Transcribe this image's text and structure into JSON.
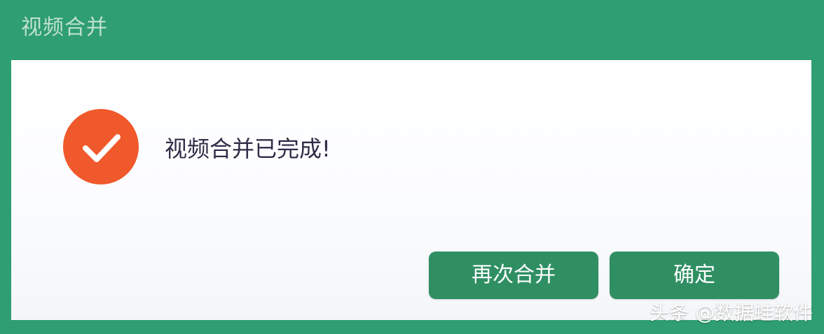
{
  "dialog": {
    "title": "视频合并",
    "message": "视频合并已完成!",
    "status_icon": "check-circle-icon",
    "buttons": {
      "merge_again": "再次合并",
      "confirm": "确定"
    }
  },
  "watermark": "头条 @数据蛙软件",
  "colors": {
    "frame": "#2f9e72",
    "title_text": "#bfe1d1",
    "icon_circle": "#f0592b",
    "button": "#2f8f63",
    "button_text": "#ffffff",
    "message_text": "#332b47"
  }
}
